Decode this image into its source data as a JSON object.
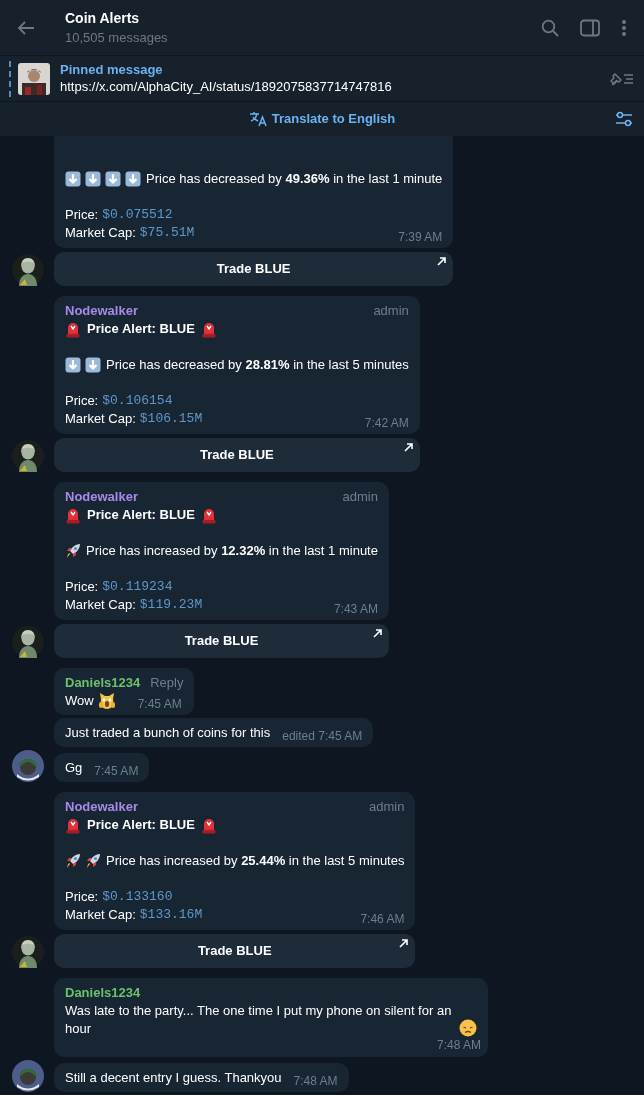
{
  "header": {
    "title": "Coin Alerts",
    "subtitle": "10,505 messages"
  },
  "pinned": {
    "label": "Pinned message",
    "text": "https://x.com/AlphaCity_AI/status/1892075837714747816"
  },
  "translate_bar": {
    "label": "Translate to English"
  },
  "messages": [
    {
      "kind": "alert",
      "avatar": {
        "kind": "bot"
      },
      "change_icons": [
        {
          "kind": "down"
        },
        {
          "kind": "down"
        },
        {
          "kind": "down"
        },
        {
          "kind": "down"
        }
      ],
      "change": "Price has decreased by **49.36%** in the last 1 minute",
      "price_label": "Price:",
      "price": "$0.075512",
      "cap_label": "Market Cap:",
      "cap": "$75.51M",
      "time": "7:39 AM",
      "button": "Trade BLUE"
    },
    {
      "kind": "alert",
      "avatar": {
        "kind": "bot"
      },
      "sender": "Nodewalker",
      "color": "#a78bea",
      "badge": "admin",
      "title": "Price Alert: BLUE",
      "change_icons": [
        {
          "kind": "down"
        },
        {
          "kind": "down"
        }
      ],
      "change": "Price has decreased by **28.81%** in the last 5 minutes",
      "price_label": "Price:",
      "price": "$0.106154",
      "cap_label": "Market Cap:",
      "cap": "$106.15M",
      "time": "7:42 AM",
      "button": "Trade BLUE"
    },
    {
      "kind": "alert",
      "avatar": {
        "kind": "bot"
      },
      "sender": "Nodewalker",
      "color": "#a78bea",
      "badge": "admin",
      "title": "Price Alert: BLUE",
      "change_icons": [
        {
          "kind": "rocket"
        }
      ],
      "change": "Price has increased by **12.32%** in the last 1 minute",
      "price_label": "Price:",
      "price": "$0.119234",
      "cap_label": "Market Cap:",
      "cap": "$119.23M",
      "time": "7:43 AM",
      "button": "Trade BLUE"
    },
    {
      "kind": "text",
      "sender": "Daniels1234",
      "color": "#6cc26c",
      "reply": "Reply",
      "text": "Wow",
      "emoji": {
        "kind": "cat"
      },
      "time": "7:45 AM"
    },
    {
      "kind": "text",
      "text": "Just traded a bunch of coins for this",
      "edited": "edited",
      "time": "7:45 AM"
    },
    {
      "kind": "text",
      "avatar": {
        "kind": "user"
      },
      "text": "Gg",
      "time": "7:45 AM"
    },
    {
      "kind": "alert",
      "avatar": {
        "kind": "bot"
      },
      "sender": "Nodewalker",
      "color": "#a78bea",
      "badge": "admin",
      "title": "Price Alert: BLUE",
      "change_icons": [
        {
          "kind": "rocket"
        },
        {
          "kind": "rocket"
        }
      ],
      "change": "Price has increased by **25.44%** in the last 5 minutes",
      "price_label": "Price:",
      "price": "$0.133160",
      "cap_label": "Market Cap:",
      "cap": "$133.16M",
      "time": "7:46 AM",
      "button": "Trade BLUE"
    },
    {
      "kind": "paragraph",
      "sender": "Daniels1234",
      "color": "#6cc26c",
      "text": "Was late to the party... The one time I put my phone on silent for an hour",
      "emoji": {
        "kind": "sad"
      },
      "time": "7:48 AM"
    },
    {
      "kind": "text",
      "avatar": {
        "kind": "user"
      },
      "text": "Still a decent entry I guess. Thankyou",
      "time": "7:48 AM"
    }
  ]
}
